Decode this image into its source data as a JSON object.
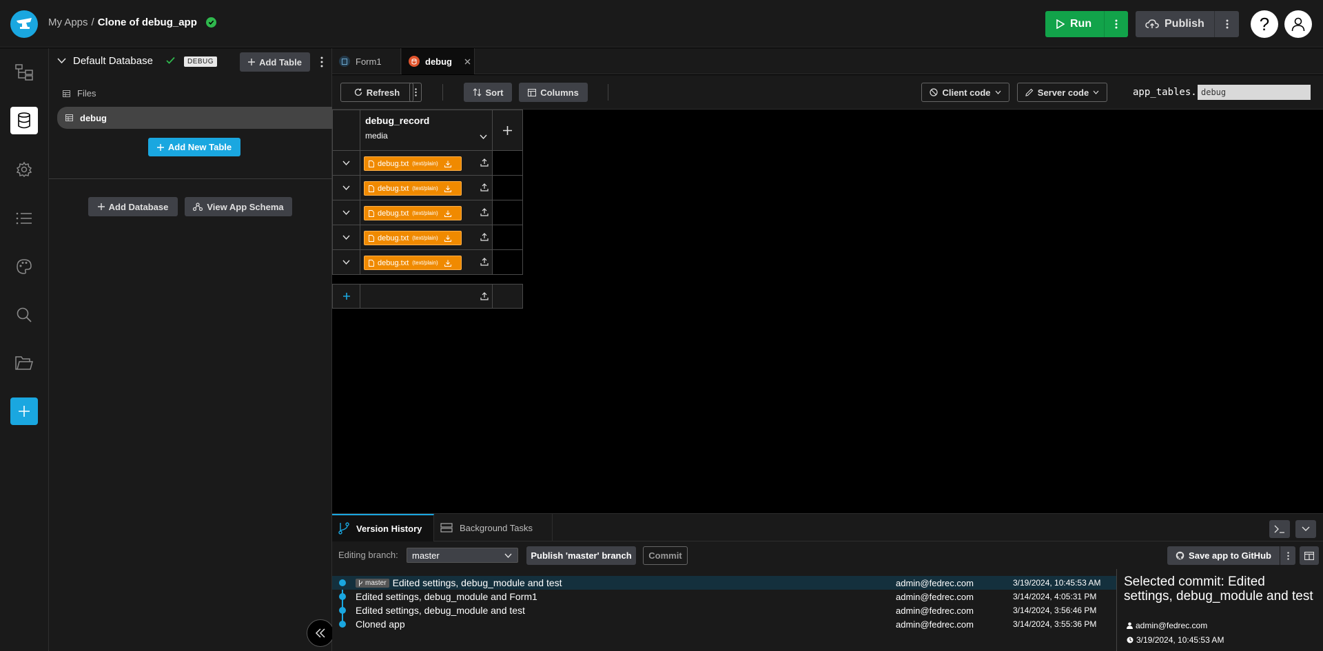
{
  "topbar": {
    "breadcrumb_root": "My Apps",
    "breadcrumb_sep": "/",
    "app_name": "Clone of debug_app",
    "run_label": "Run",
    "publish_label": "Publish",
    "help_label": "?"
  },
  "db_panel": {
    "title": "Default Database",
    "badge": "DEBUG",
    "add_table_label": "Add Table",
    "files_label": "Files",
    "table_name": "debug",
    "add_new_table_label": "Add New Table",
    "add_database_label": "Add Database",
    "view_schema_label": "View App Schema"
  },
  "editor_tabs": [
    {
      "label": "Form1",
      "active": false
    },
    {
      "label": "debug",
      "active": true
    }
  ],
  "toolbar": {
    "refresh_label": "Refresh",
    "sort_label": "Sort",
    "columns_label": "Columns",
    "client_code_label": "Client code",
    "server_code_label": "Server code",
    "app_tables_prefix": "app_tables.",
    "app_tables_value": "debug"
  },
  "grid": {
    "column_title": "debug_record",
    "column_type": "media",
    "rows": [
      {
        "file": "debug.txt",
        "mime": "(text/plain)"
      },
      {
        "file": "debug.txt",
        "mime": "(text/plain)"
      },
      {
        "file": "debug.txt",
        "mime": "(text/plain)"
      },
      {
        "file": "debug.txt",
        "mime": "(text/plain)"
      },
      {
        "file": "debug.txt",
        "mime": "(text/plain)"
      }
    ]
  },
  "bottom": {
    "tabs": [
      {
        "label": "Version History",
        "active": true
      },
      {
        "label": "Background Tasks",
        "active": false
      }
    ],
    "editing_branch_label": "Editing branch:",
    "branch_value": "master",
    "publish_branch_label": "Publish 'master' branch",
    "commit_label": "Commit",
    "github_label": "Save app to GitHub",
    "commits": [
      {
        "branch_tag": "master",
        "message": "Edited settings, debug_module and test",
        "author": "admin@fedrec.com",
        "date": "3/19/2024, 10:45:53 AM",
        "selected": true
      },
      {
        "branch_tag": "",
        "message": "Edited settings, debug_module and Form1",
        "author": "admin@fedrec.com",
        "date": "3/14/2024, 4:05:31 PM",
        "selected": false
      },
      {
        "branch_tag": "",
        "message": "Edited settings, debug_module and test",
        "author": "admin@fedrec.com",
        "date": "3/14/2024, 3:56:46 PM",
        "selected": false
      },
      {
        "branch_tag": "",
        "message": "Cloned app",
        "author": "admin@fedrec.com",
        "date": "3/14/2024, 3:55:36 PM",
        "selected": false
      }
    ],
    "selected_commit": {
      "title": "Selected commit: Edited settings, debug_module and test",
      "author": "admin@fedrec.com",
      "date": "3/19/2024, 10:45:53 AM"
    }
  },
  "colors": {
    "accent": "#1aa7e0",
    "run_green": "#12a34a",
    "media_orange": "#f08a00"
  }
}
